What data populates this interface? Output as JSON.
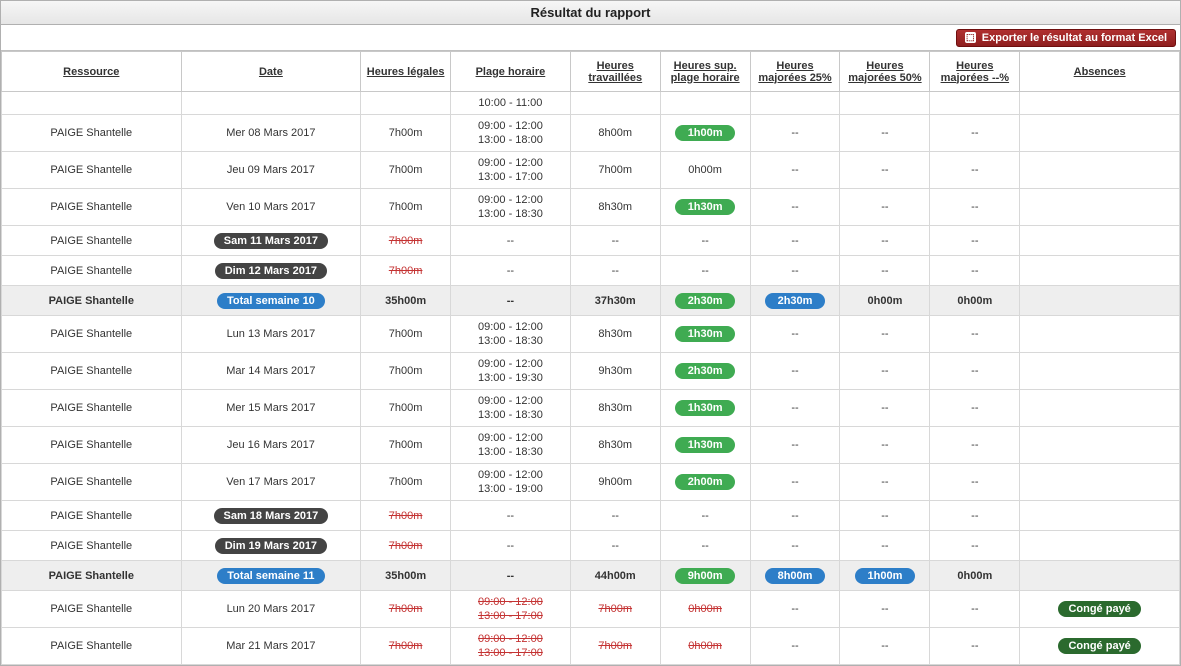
{
  "title": "Résultat du rapport",
  "export_label": "Exporter le résultat au format Excel",
  "headers": {
    "resource": "Ressource",
    "date": "Date",
    "legal": "Heures légales",
    "plage": "Plage horaire",
    "worked": "Heures travaillées",
    "overtime": "Heures sup. plage horaire",
    "m25": "Heures majorées 25%",
    "m50": "Heures majorées 50%",
    "mx": "Heures majorées --%",
    "abs": "Absences"
  },
  "rows": [
    {
      "type": "cut",
      "p1": "10:00 - 11:00",
      "p2": "",
      "strike": false
    },
    {
      "type": "data",
      "res": "PAIGE Shantelle",
      "date": "Mer 08 Mars 2017",
      "legal": "7h00m",
      "p1": "09:00 - 12:00",
      "p2": "13:00 - 18:00",
      "worked": "8h00m",
      "ot": "1h00m",
      "ot_style": "pill-green",
      "m25": "--",
      "m50": "--",
      "mx": "--",
      "abs": ""
    },
    {
      "type": "data",
      "res": "PAIGE Shantelle",
      "date": "Jeu 09 Mars 2017",
      "legal": "7h00m",
      "p1": "09:00 - 12:00",
      "p2": "13:00 - 17:00",
      "worked": "7h00m",
      "ot": "0h00m",
      "ot_style": "",
      "m25": "--",
      "m50": "--",
      "mx": "--",
      "abs": ""
    },
    {
      "type": "data",
      "res": "PAIGE Shantelle",
      "date": "Ven 10 Mars 2017",
      "legal": "7h00m",
      "p1": "09:00 - 12:00",
      "p2": "13:00 - 18:30",
      "worked": "8h30m",
      "ot": "1h30m",
      "ot_style": "pill-green",
      "m25": "--",
      "m50": "--",
      "mx": "--",
      "abs": ""
    },
    {
      "type": "weekend",
      "res": "PAIGE Shantelle",
      "date": "Sam 11 Mars 2017",
      "legal": "7h00m"
    },
    {
      "type": "weekend",
      "res": "PAIGE Shantelle",
      "date": "Dim 12 Mars 2017",
      "legal": "7h00m"
    },
    {
      "type": "total",
      "res": "PAIGE Shantelle",
      "date": "Total semaine 10",
      "legal": "35h00m",
      "plage": "--",
      "worked": "37h30m",
      "ot": "2h30m",
      "m25": "2h30m",
      "m25_style": "pill-blue",
      "m50": "0h00m",
      "mx": "0h00m"
    },
    {
      "type": "data",
      "res": "PAIGE Shantelle",
      "date": "Lun 13 Mars 2017",
      "legal": "7h00m",
      "p1": "09:00 - 12:00",
      "p2": "13:00 - 18:30",
      "worked": "8h30m",
      "ot": "1h30m",
      "ot_style": "pill-green",
      "m25": "--",
      "m50": "--",
      "mx": "--",
      "abs": ""
    },
    {
      "type": "data",
      "res": "PAIGE Shantelle",
      "date": "Mar 14 Mars 2017",
      "legal": "7h00m",
      "p1": "09:00 - 12:00",
      "p2": "13:00 - 19:30",
      "worked": "9h30m",
      "ot": "2h30m",
      "ot_style": "pill-green",
      "m25": "--",
      "m50": "--",
      "mx": "--",
      "abs": ""
    },
    {
      "type": "data",
      "res": "PAIGE Shantelle",
      "date": "Mer 15 Mars 2017",
      "legal": "7h00m",
      "p1": "09:00 - 12:00",
      "p2": "13:00 - 18:30",
      "worked": "8h30m",
      "ot": "1h30m",
      "ot_style": "pill-green",
      "m25": "--",
      "m50": "--",
      "mx": "--",
      "abs": ""
    },
    {
      "type": "data",
      "res": "PAIGE Shantelle",
      "date": "Jeu 16 Mars 2017",
      "legal": "7h00m",
      "p1": "09:00 - 12:00",
      "p2": "13:00 - 18:30",
      "worked": "8h30m",
      "ot": "1h30m",
      "ot_style": "pill-green",
      "m25": "--",
      "m50": "--",
      "mx": "--",
      "abs": ""
    },
    {
      "type": "data",
      "res": "PAIGE Shantelle",
      "date": "Ven 17 Mars 2017",
      "legal": "7h00m",
      "p1": "09:00 - 12:00",
      "p2": "13:00 - 19:00",
      "worked": "9h00m",
      "ot": "2h00m",
      "ot_style": "pill-green",
      "m25": "--",
      "m50": "--",
      "mx": "--",
      "abs": ""
    },
    {
      "type": "weekend",
      "res": "PAIGE Shantelle",
      "date": "Sam 18 Mars 2017",
      "legal": "7h00m"
    },
    {
      "type": "weekend",
      "res": "PAIGE Shantelle",
      "date": "Dim 19 Mars 2017",
      "legal": "7h00m"
    },
    {
      "type": "total",
      "res": "PAIGE Shantelle",
      "date": "Total semaine 11",
      "legal": "35h00m",
      "plage": "--",
      "worked": "44h00m",
      "ot": "9h00m",
      "m25": "8h00m",
      "m25_style": "pill-blue",
      "m50": "1h00m",
      "m50_style": "pill-blue",
      "mx": "0h00m"
    },
    {
      "type": "data",
      "res": "PAIGE Shantelle",
      "date": "Lun 20 Mars 2017",
      "legal": "7h00m",
      "legal_strike": true,
      "p1": "09:00 - 12:00",
      "p2": "13:00 - 17:00",
      "plage_strike": true,
      "worked": "7h00m",
      "worked_strike": true,
      "ot": "0h00m",
      "ot_strike": true,
      "ot_style": "",
      "m25": "--",
      "m50": "--",
      "mx": "--",
      "abs": "Congé payé",
      "abs_style": "pill-darkgreen"
    },
    {
      "type": "data",
      "res": "PAIGE Shantelle",
      "date": "Mar 21 Mars 2017",
      "legal": "7h00m",
      "legal_strike": true,
      "p1": "09:00 - 12:00",
      "p2": "13:00 - 17:00",
      "plage_strike": true,
      "worked": "7h00m",
      "worked_strike": true,
      "ot": "0h00m",
      "ot_strike": true,
      "ot_style": "",
      "m25": "--",
      "m50": "--",
      "mx": "--",
      "abs": "Congé payé",
      "abs_style": "pill-darkgreen"
    }
  ]
}
